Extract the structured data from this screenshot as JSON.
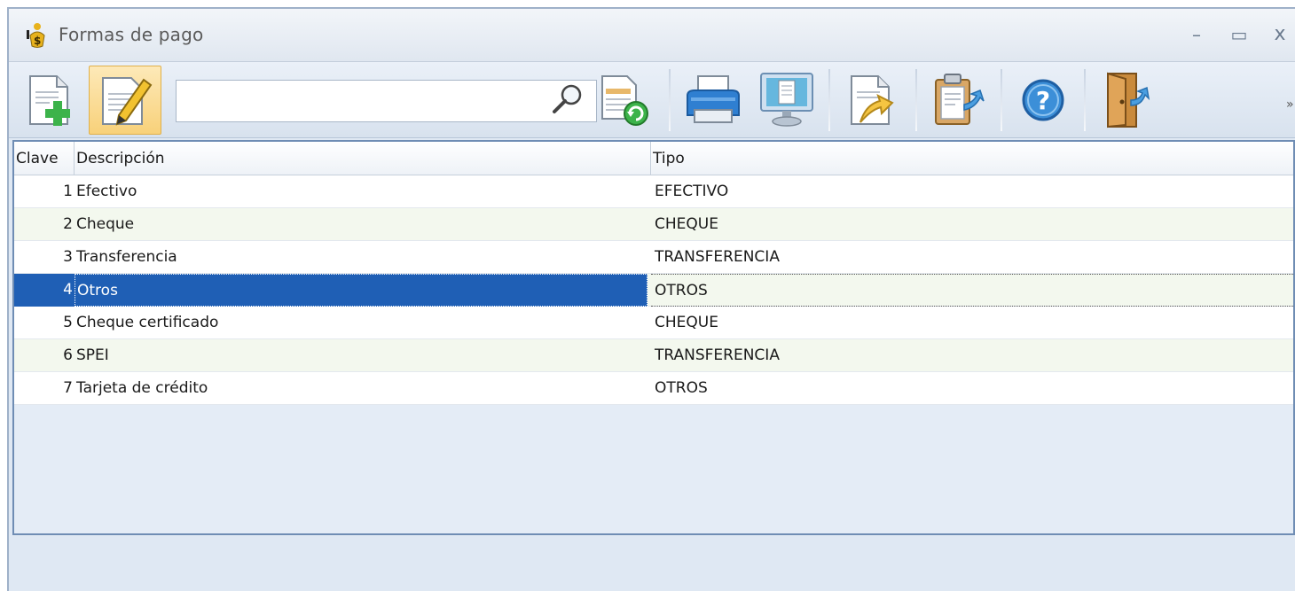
{
  "window": {
    "title": "Formas de pago",
    "controls": {
      "minimize": "–",
      "maximize": "▭",
      "close": "x"
    }
  },
  "toolbar": {
    "search": {
      "value": "",
      "placeholder": ""
    },
    "buttons": [
      {
        "icon": "add-document-icon"
      },
      {
        "icon": "edit-document-icon",
        "active": true
      },
      {
        "icon": "search-icon"
      },
      {
        "icon": "refresh-list-icon"
      },
      {
        "icon": "printer-icon"
      },
      {
        "icon": "preview-monitor-icon"
      },
      {
        "icon": "export-document-icon"
      },
      {
        "icon": "clipboard-paste-icon"
      },
      {
        "icon": "help-icon"
      },
      {
        "icon": "exit-door-icon"
      }
    ]
  },
  "grid": {
    "columns": [
      "Clave",
      "Descripción",
      "Tipo"
    ],
    "rows": [
      {
        "clave": "1",
        "descripcion": "Efectivo",
        "tipo": "EFECTIVO"
      },
      {
        "clave": "2",
        "descripcion": "Cheque",
        "tipo": "CHEQUE"
      },
      {
        "clave": "3",
        "descripcion": "Transferencia",
        "tipo": "TRANSFERENCIA"
      },
      {
        "clave": "4",
        "descripcion": "Otros",
        "tipo": "OTROS",
        "selected": true
      },
      {
        "clave": "5",
        "descripcion": "Cheque certificado",
        "tipo": "CHEQUE"
      },
      {
        "clave": "6",
        "descripcion": "SPEI",
        "tipo": "TRANSFERENCIA"
      },
      {
        "clave": "7",
        "descripcion": "Tarjeta de crédito",
        "tipo": "OTROS"
      }
    ]
  },
  "colors": {
    "selection": "#1f5fb5",
    "grid_border": "#6f8db4",
    "window_bg": "#dfe8f3"
  }
}
